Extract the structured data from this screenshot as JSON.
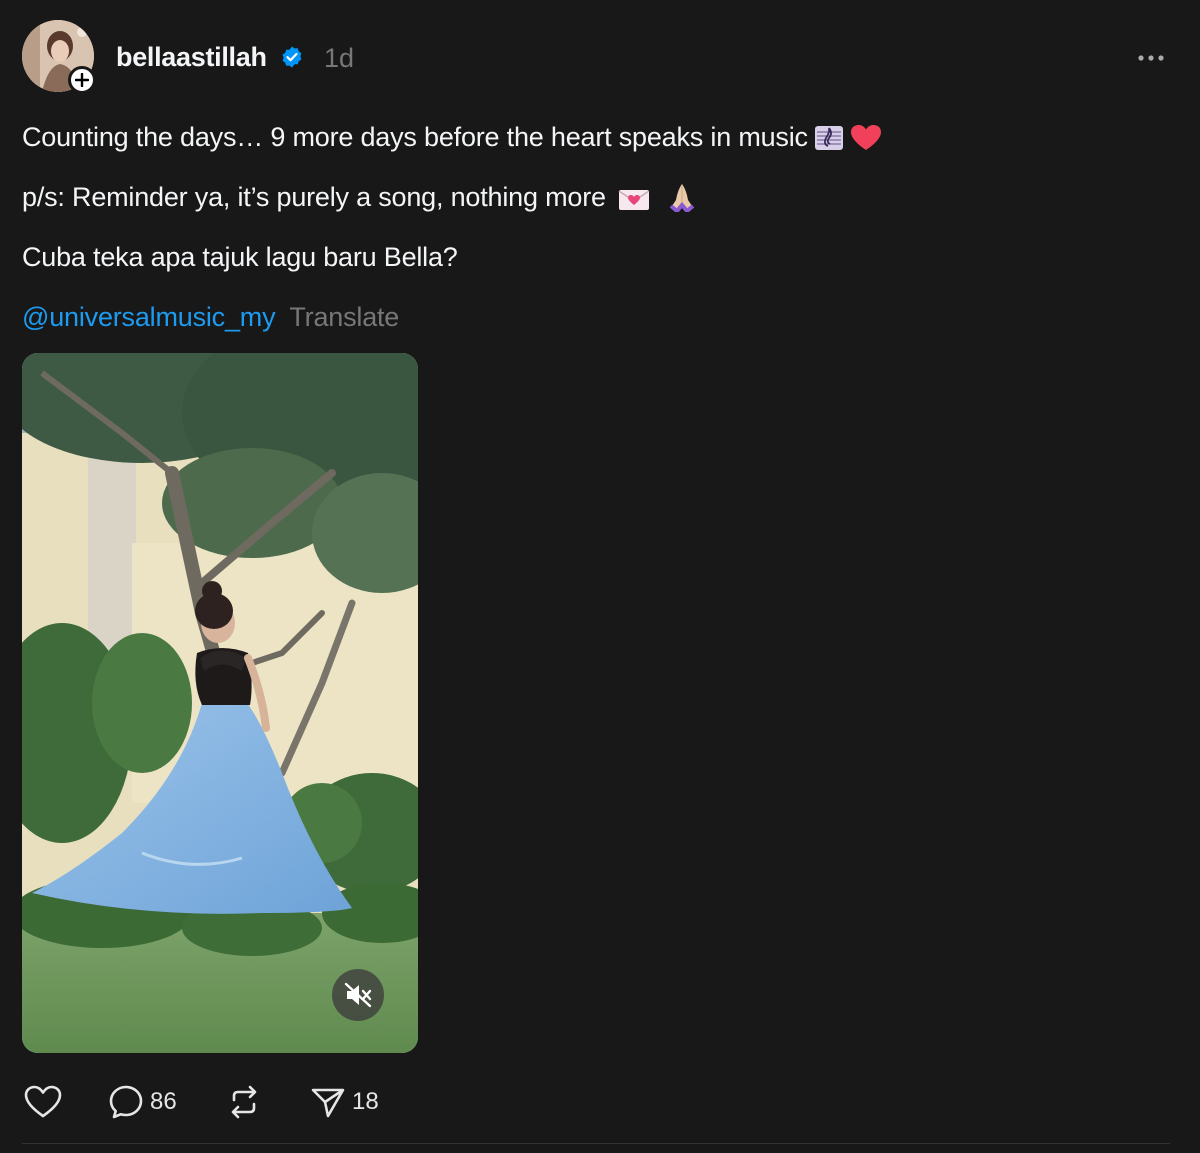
{
  "post": {
    "username": "bellaastillah",
    "timestamp": "1d",
    "lines": [
      "Counting the days… 9 more days before the heart speaks in music",
      "p/s: Reminder ya, it’s purely a song, nothing more",
      "Cuba teka apa tajuk lagu baru Bella?"
    ],
    "mention": "@universalmusic_my",
    "translate_label": "Translate"
  },
  "actions": {
    "replies": "86",
    "shares": "18"
  },
  "icons": {
    "verified": "verified-badge-icon",
    "more": "more-options-icon",
    "mute": "muted-speaker-icon",
    "like": "heart-icon",
    "reply": "comment-icon",
    "repost": "repost-icon",
    "share": "send-icon"
  },
  "colors": {
    "background": "#181818",
    "text": "#f3f5f7",
    "muted": "#777777",
    "link": "#1d9bf0",
    "verified": "#0095f6"
  }
}
